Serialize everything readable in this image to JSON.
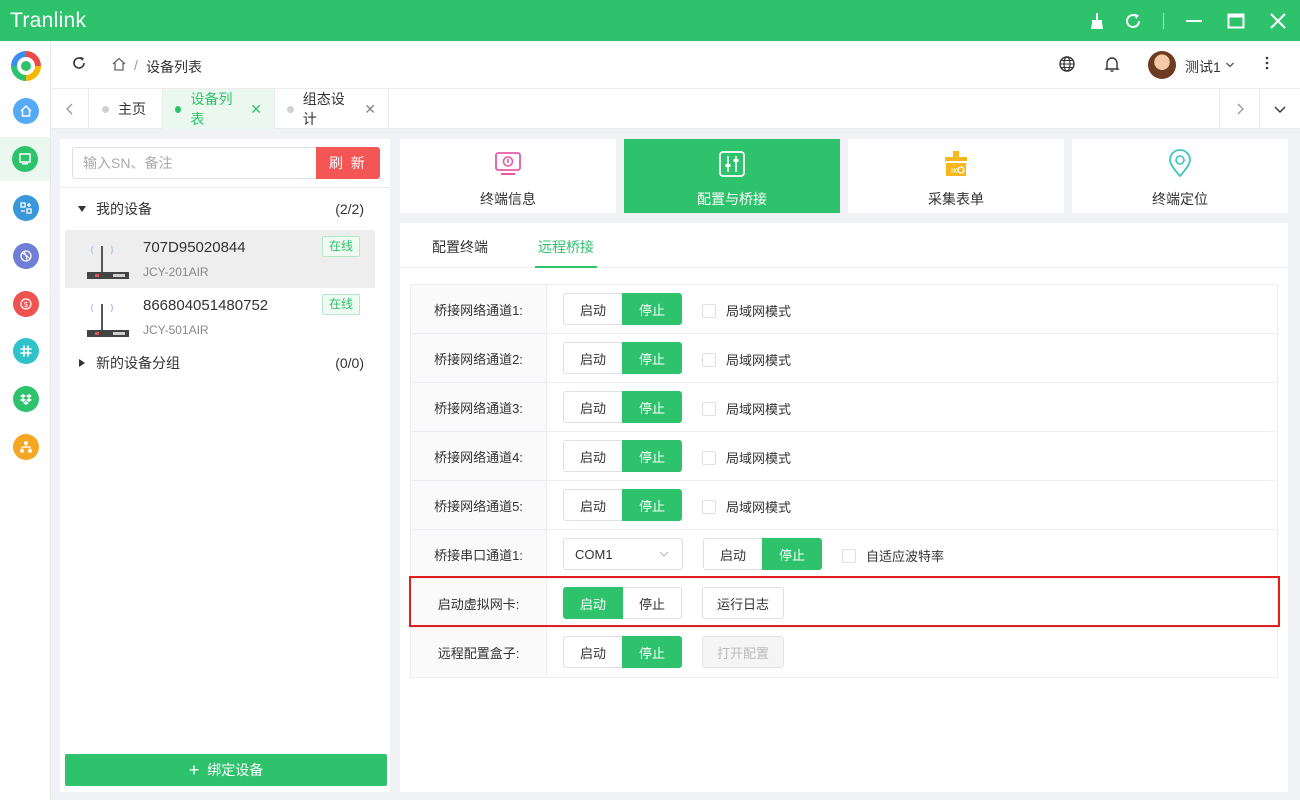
{
  "window": {
    "title": "Tranlink",
    "controls": [
      "broom-icon",
      "refresh-icon",
      "minimize-icon",
      "maximize-icon",
      "close-icon"
    ]
  },
  "colors": {
    "brand": "#2fc26c",
    "danger": "#f45656",
    "highlight": "#e02020"
  },
  "rail": {
    "items": [
      {
        "icon": "home-icon",
        "color": "#56a9f5"
      },
      {
        "icon": "monitor-icon",
        "color": "#2fc26c",
        "active": true
      },
      {
        "icon": "app-grid-icon",
        "color": "#3b98d8"
      },
      {
        "icon": "dribbble-icon",
        "color": "#6f7fd8"
      },
      {
        "icon": "dollar-icon",
        "color": "#ef5350"
      },
      {
        "icon": "slack-icon",
        "color": "#30c2c9"
      },
      {
        "icon": "dropbox-icon",
        "color": "#2fc26c"
      },
      {
        "icon": "sitemap-icon",
        "color": "#f5a623"
      }
    ]
  },
  "header": {
    "breadcrumb": "设备列表",
    "user": "测试1"
  },
  "tabs": [
    {
      "label": "主页",
      "closable": false,
      "active": false
    },
    {
      "label": "设备列表",
      "closable": true,
      "active": true
    },
    {
      "label": "组态设计",
      "closable": true,
      "active": false
    }
  ],
  "devices": {
    "search_placeholder": "输入SN、备注",
    "refresh_label": "刷 新",
    "groups": [
      {
        "name": "我的设备",
        "count": "(2/2)",
        "expanded": true
      },
      {
        "name": "新的设备分组",
        "count": "(0/0)",
        "expanded": false
      }
    ],
    "items": [
      {
        "sn": "707D95020844",
        "model": "JCY-201AIR",
        "status": "在线"
      },
      {
        "sn": "866804051480752",
        "model": "JCY-501AIR",
        "status": "在线"
      }
    ],
    "bind_label": "绑定设备"
  },
  "cards": [
    {
      "label": "终端信息",
      "icon": "terminal-info-icon"
    },
    {
      "label": "配置与桥接",
      "icon": "sliders-icon",
      "active": true
    },
    {
      "label": "采集表单",
      "icon": "collection-form-icon"
    },
    {
      "label": "终端定位",
      "icon": "location-pin-icon"
    }
  ],
  "subtabs": [
    {
      "label": "配置终端",
      "active": false
    },
    {
      "label": "远程桥接",
      "active": true
    }
  ],
  "bridge": {
    "start_label": "启动",
    "stop_label": "停止",
    "lan_label": "局域网模式",
    "adaptive_label": "自适应波特率",
    "log_label": "运行日志",
    "open_config_label": "打开配置",
    "net_channels": [
      {
        "label": "桥接网络通道1:",
        "state": "停止"
      },
      {
        "label": "桥接网络通道2:",
        "state": "停止"
      },
      {
        "label": "桥接网络通道3:",
        "state": "停止"
      },
      {
        "label": "桥接网络通道4:",
        "state": "停止"
      },
      {
        "label": "桥接网络通道5:",
        "state": "停止"
      }
    ],
    "serial": {
      "label": "桥接串口通道1:",
      "port": "COM1",
      "state": "停止"
    },
    "vnic": {
      "label": "启动虚拟网卡:",
      "state": "启动"
    },
    "box": {
      "label": "远程配置盒子:",
      "state": "停止"
    }
  }
}
